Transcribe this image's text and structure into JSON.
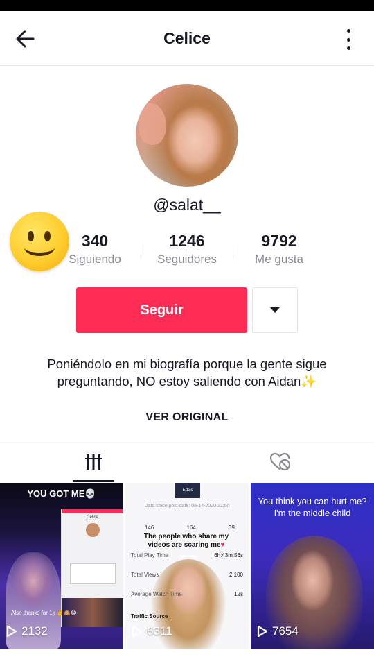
{
  "header": {
    "title": "Celice",
    "back_icon": "arrow-left-icon",
    "more_icon": "vertical-dots-icon"
  },
  "profile": {
    "username": "@salat__",
    "stats": [
      {
        "value": "340",
        "label": "Siguiendo"
      },
      {
        "value": "1246",
        "label": "Seguidores"
      },
      {
        "value": "9792",
        "label": "Me gusta"
      }
    ],
    "follow_label": "Seguir",
    "dropdown_icon": "caret-down-icon",
    "bio": "Poniéndolo en mi biografía porque la gente sigue preguntando, NO estoy saliendo con Aidan",
    "bio_emoji": "✨",
    "see_original": "VER ORIGINAL"
  },
  "overlay": {
    "emoji": "smiling-face-icon"
  },
  "tabs": [
    {
      "name": "videos",
      "icon": "grid-bars-icon",
      "active": true
    },
    {
      "name": "liked",
      "icon": "liked-hidden-icon",
      "active": false
    }
  ],
  "videos": [
    {
      "caption": "YOU GOT ME💀",
      "sub_caption": "Also thanks for 1k ✌️🙈😂",
      "phone_title": "Celice",
      "views": "2132"
    },
    {
      "thumb_label": "5.13s",
      "date_line": "Data since post date: 08-14-2020 22:50",
      "counts": [
        "146",
        "164",
        "39"
      ],
      "overlay_text": "The people who share my videos are scaring me",
      "rows": [
        {
          "label": "Total Play Time",
          "value": "6h:43m:56s"
        },
        {
          "label": "Total Views",
          "value": "2,100"
        },
        {
          "label": "Average Watch Time",
          "value": "12s"
        }
      ],
      "traffic": "Traffic Source",
      "views": "6311"
    },
    {
      "caption": "You think you can hurt me? I'm the middle child",
      "views": "7654"
    }
  ],
  "colors": {
    "accent": "#fe2c55",
    "text": "#161823",
    "muted": "#8a8b91",
    "divider": "#e3e3e4"
  }
}
